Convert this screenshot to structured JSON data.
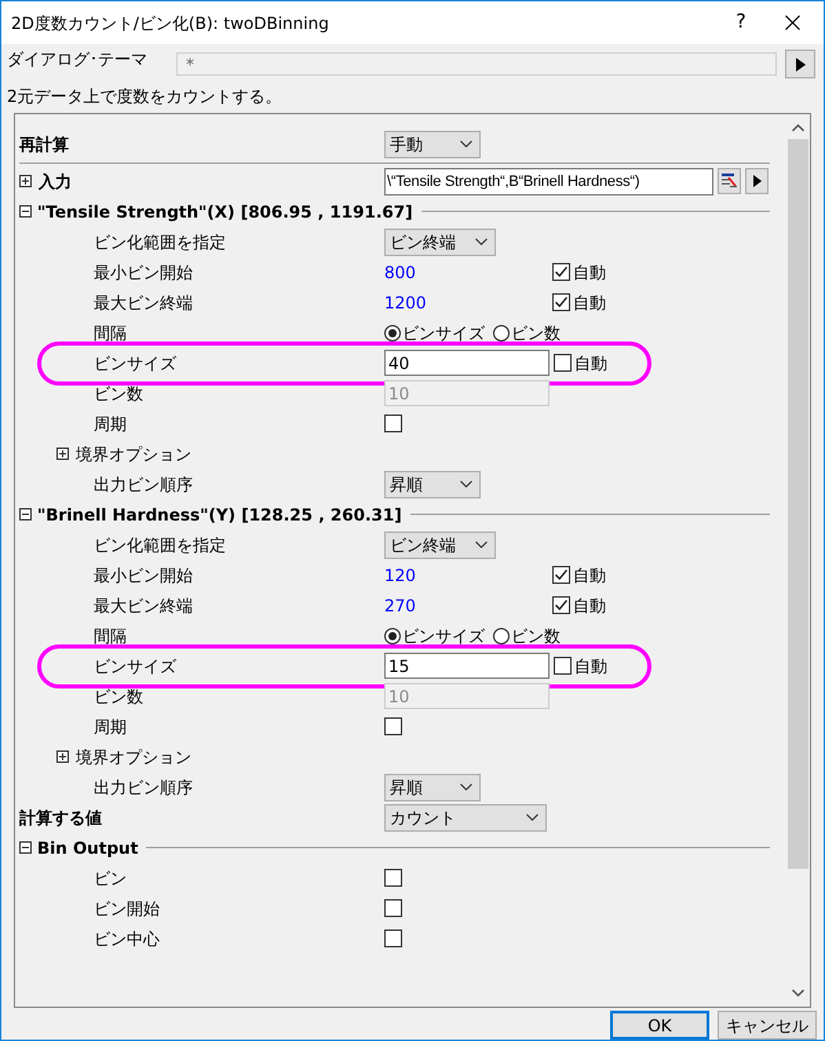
{
  "window": {
    "title": "2D度数カウント/ビン化(B): twoDBinning",
    "help": "?"
  },
  "theme": {
    "label": "ダイアログ･テーマ",
    "value": "*"
  },
  "description": "2元データ上で度数をカウントする。",
  "items": [
    {
      "kind": "dropdown",
      "label": "再計算",
      "value": "手動"
    },
    {
      "kind": "range",
      "label": "入力",
      "expanded": false,
      "value": "\\“Tensile Strength“,B“Brinell Hardness“)"
    },
    {
      "kind": "section",
      "label": "\"Tensile Strength\"(X) [806.95 , 1191.67]",
      "expanded": true,
      "children": [
        {
          "kind": "dropdown",
          "label": "ビン化範囲を指定",
          "value": "ビン終端"
        },
        {
          "kind": "auto_value",
          "label": "最小ビン開始",
          "value": "800",
          "auto_label": "自動",
          "checked": true
        },
        {
          "kind": "auto_value",
          "label": "最大ビン終端",
          "value": "1200",
          "auto_label": "自動",
          "checked": true
        },
        {
          "kind": "radio",
          "label": "間隔",
          "options": [
            {
              "label": "ビンサイズ",
              "selected": true
            },
            {
              "label": "ビン数",
              "selected": false
            }
          ]
        },
        {
          "kind": "field_auto",
          "label": "ビンサイズ",
          "value": "40",
          "auto_label": "自動",
          "checked": false,
          "highlighted": true
        },
        {
          "kind": "disabled_field",
          "label": "ビン数",
          "value": "10"
        },
        {
          "kind": "checkbox",
          "label": "周期",
          "checked": false
        },
        {
          "kind": "group",
          "label": "境界オプション",
          "expanded": false
        },
        {
          "kind": "dropdown",
          "label": "出力ビン順序",
          "value": "昇順"
        }
      ]
    },
    {
      "kind": "section",
      "label": "\"Brinell Hardness\"(Y) [128.25 , 260.31]",
      "expanded": true,
      "children": [
        {
          "kind": "dropdown",
          "label": "ビン化範囲を指定",
          "value": "ビン終端"
        },
        {
          "kind": "auto_value",
          "label": "最小ビン開始",
          "value": "120",
          "auto_label": "自動",
          "checked": true
        },
        {
          "kind": "auto_value",
          "label": "最大ビン終端",
          "value": "270",
          "auto_label": "自動",
          "checked": true
        },
        {
          "kind": "radio",
          "label": "間隔",
          "options": [
            {
              "label": "ビンサイズ",
              "selected": true
            },
            {
              "label": "ビン数",
              "selected": false
            }
          ]
        },
        {
          "kind": "field_auto",
          "label": "ビンサイズ",
          "value": "15",
          "auto_label": "自動",
          "checked": false,
          "highlighted": true
        },
        {
          "kind": "disabled_field",
          "label": "ビン数",
          "value": "10"
        },
        {
          "kind": "checkbox",
          "label": "周期",
          "checked": false
        },
        {
          "kind": "group",
          "label": "境界オプション",
          "expanded": false
        },
        {
          "kind": "dropdown",
          "label": "出力ビン順序",
          "value": "昇順"
        }
      ]
    },
    {
      "kind": "dropdown",
      "label": "計算する値",
      "value": "カウント"
    },
    {
      "kind": "section",
      "label": "Bin Output",
      "expanded": true,
      "children": [
        {
          "kind": "checkbox",
          "label": "ビン",
          "checked": false
        },
        {
          "kind": "checkbox",
          "label": "ビン開始",
          "checked": false
        },
        {
          "kind": "checkbox",
          "label": "ビン中心",
          "checked": false
        }
      ]
    }
  ],
  "buttons": [
    {
      "label": "OK",
      "default": true
    },
    {
      "label": "キャンセル",
      "default": false
    }
  ]
}
